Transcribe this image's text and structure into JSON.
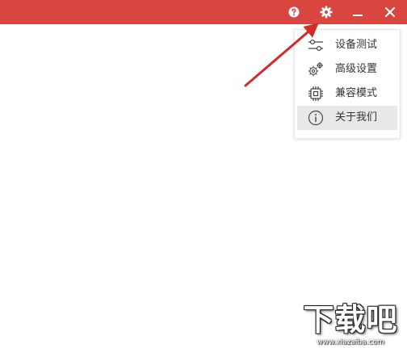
{
  "titlebar": {
    "background": "#d9453f",
    "buttons": {
      "help_icon": "question-circle-icon",
      "settings_icon": "gear-icon",
      "minimize_icon": "minimize-icon",
      "close_icon": "close-icon"
    }
  },
  "settings_menu": {
    "items": [
      {
        "label": "设备测试",
        "icon": "sliders-icon",
        "active": false
      },
      {
        "label": "高级设置",
        "icon": "gears-icon",
        "active": false
      },
      {
        "label": "兼容模式",
        "icon": "chip-icon",
        "active": false
      },
      {
        "label": "关于我们",
        "icon": "info-circle-icon",
        "active": true
      }
    ]
  },
  "annotation": {
    "arrow_color": "#d32a2a"
  },
  "watermark": {
    "text": "下载吧",
    "url": "www.xiazaiba.com"
  }
}
